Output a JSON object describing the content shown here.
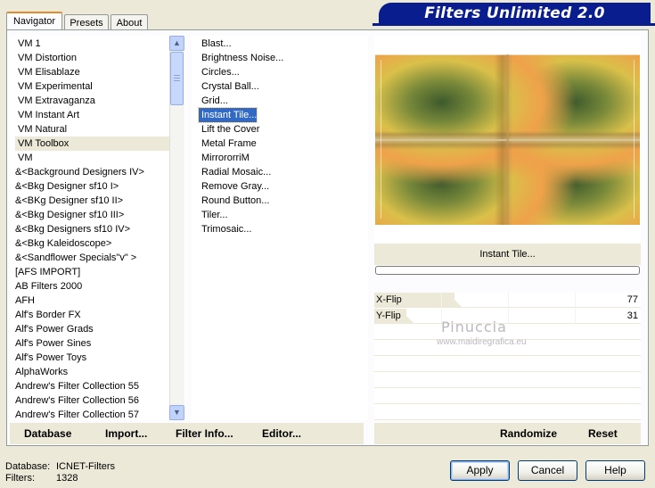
{
  "tabs": [
    "Navigator",
    "Presets",
    "About"
  ],
  "header_title": "Filters Unlimited 2.0",
  "categories": {
    "items": [
      "VM 1",
      "VM Distortion",
      "VM Elisablaze",
      "VM Experimental",
      "VM Extravaganza",
      "VM Instant Art",
      "VM Natural",
      "VM Toolbox",
      "VM",
      "&<Background Designers IV>",
      "&<Bkg Designer sf10 I>",
      "&<BKg Designer sf10 II>",
      "&<Bkg Designer sf10 III>",
      "&<Bkg Designers sf10 IV>",
      "&<Bkg Kaleidoscope>",
      "&<Sandflower Specials\"v\" >",
      "[AFS IMPORT]",
      "AB Filters 2000",
      "AFH",
      "Alf's Border FX",
      "Alf's Power Grads",
      "Alf's Power Sines",
      "Alf's Power Toys",
      "AlphaWorks",
      "Andrew's Filter Collection 55",
      "Andrew's Filter Collection 56",
      "Andrew's Filter Collection 57"
    ],
    "selected": "VM Toolbox"
  },
  "filters": {
    "items": [
      "Blast...",
      "Brightness Noise...",
      "Circles...",
      "Crystal Ball...",
      "Grid...",
      "Instant Tile...",
      "Lift the Cover",
      "Metal Frame",
      "MirrororriM",
      "Radial Mosaic...",
      "Remove Gray...",
      "Round Button...",
      "Tiler...",
      "Trimosaic..."
    ],
    "selected": "Instant Tile..."
  },
  "left_actions": {
    "database": "Database",
    "import": "Import...",
    "filter_info": "Filter Info...",
    "editor": "Editor..."
  },
  "right_actions": {
    "randomize": "Randomize",
    "reset": "Reset"
  },
  "current_filter_label": "Instant Tile...",
  "parameters": [
    {
      "name": "X-Flip",
      "value": "77",
      "level": 77
    },
    {
      "name": "Y-Flip",
      "value": "31",
      "level": 31
    }
  ],
  "watermark": {
    "name": "Pinuccia",
    "url": "www.maidiregrafica.eu"
  },
  "footer": {
    "database_label": "Database:",
    "database_value": "ICNET-Filters",
    "filters_label": "Filters:",
    "filters_value": "1328"
  },
  "buttons": {
    "apply": "Apply",
    "cancel": "Cancel",
    "help": "Help"
  },
  "colors": {
    "banner": "#0a1d8f",
    "selection": "#316ac5",
    "dialog_bg": "#ece9d8"
  }
}
